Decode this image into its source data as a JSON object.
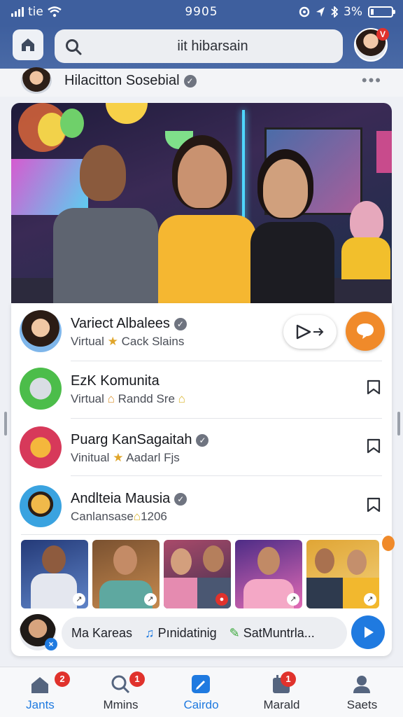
{
  "status_bar": {
    "carrier": "tie",
    "time": "9905",
    "battery": "3%"
  },
  "header": {
    "search_text": "iit hibarsain",
    "profile_badge": "V"
  },
  "post_owner": {
    "name": "Hilacitton Sosebial"
  },
  "list": [
    {
      "title": "Varieсt Albalees",
      "sub_prefix": "Virtual",
      "sub_suffix": "Cack Slains",
      "verified": true
    },
    {
      "title": "EzK Komunita",
      "sub_prefix": "Virtual",
      "sub_suffix": "Randd Sre",
      "verified": false
    },
    {
      "title": "Puarg KanSagaitah",
      "sub_prefix": "Vinitual",
      "sub_suffix": "Aadarl Fjs",
      "verified": true
    },
    {
      "title": "Andlteia Mausia",
      "sub_prefix": "Canlansase",
      "sub_suffix": "1206",
      "verified": true
    }
  ],
  "composer": {
    "chip1": "Ma Kareas",
    "chip2": "Pınidatinig",
    "chip3": "SatMuntrla..."
  },
  "nav": [
    {
      "label": "Jants",
      "badge": "2"
    },
    {
      "label": "Mmins",
      "badge": "1"
    },
    {
      "label": "Cairdo",
      "badge": ""
    },
    {
      "label": "Marald",
      "badge": "1"
    },
    {
      "label": "Saets",
      "badge": ""
    }
  ],
  "colors": {
    "brand": "#3e5f9e",
    "accent": "#1f7ae0",
    "orange": "#f08a2a",
    "badge": "#e0322c"
  }
}
